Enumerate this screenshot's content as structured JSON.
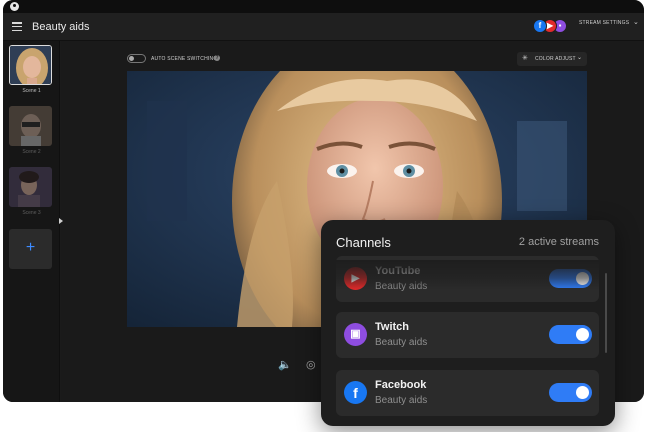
{
  "header": {
    "title": "Beauty aids",
    "stream_settings_label": "STREAM SETTINGS",
    "social_icons": [
      "facebook-icon",
      "youtube-icon",
      "twitch-icon"
    ]
  },
  "scenes": [
    {
      "label": "Scene 1",
      "active": true
    },
    {
      "label": "Scene 2",
      "active": false
    },
    {
      "label": "Scene 3",
      "active": false
    }
  ],
  "controls": {
    "auto_switch_label": "AUTO SCENE SWITCHING",
    "auto_switch_on": false,
    "color_adjust_label": "COLOR ADJUST"
  },
  "channels": {
    "title": "Channels",
    "count_text": "2 active streams",
    "items": [
      {
        "name": "YouTube",
        "subtitle": "Beauty aids",
        "enabled": true,
        "color": "#e22a2a"
      },
      {
        "name": "Twitch",
        "subtitle": "Beauty aids",
        "enabled": true,
        "color": "#8e4de0"
      },
      {
        "name": "Facebook",
        "subtitle": "Beauty aids",
        "enabled": true,
        "color": "#1877f2"
      }
    ]
  },
  "colors": {
    "accent": "#2f7cf6",
    "background": "#1b1b1b",
    "panel": "#1e1e1e"
  }
}
